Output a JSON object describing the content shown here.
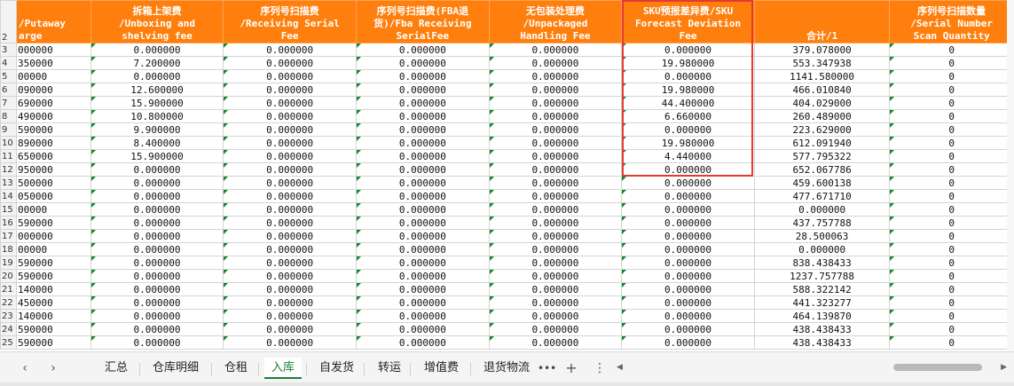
{
  "columns": [
    {
      "lines": [
        "/Putaway",
        "arge"
      ],
      "align": "left"
    },
    {
      "lines": [
        "拆箱上架费",
        "/Unboxing and",
        "shelving fee"
      ]
    },
    {
      "lines": [
        "序列号扫描费",
        "/Receiving Serial",
        "Fee"
      ]
    },
    {
      "lines": [
        "序列号扫描费(FBA退",
        "货)/Fba Receiving",
        "SerialFee"
      ]
    },
    {
      "lines": [
        "无包装处理费",
        "/Unpackaged",
        "Handling Fee"
      ]
    },
    {
      "lines": [
        "SKU预报差异费/SKU",
        "Forecast Deviation",
        "Fee"
      ]
    },
    {
      "lines": [
        "合计/1"
      ]
    },
    {
      "lines": [
        "序列号扫描数量",
        "/Serial Number",
        "Scan Quantity"
      ]
    }
  ],
  "rows": [
    {
      "num": "3",
      "cells": [
        "000000",
        "0.000000",
        "0.000000",
        "0.000000",
        "0.000000",
        "0.000000",
        "379.078000",
        "0"
      ]
    },
    {
      "num": "4",
      "cells": [
        "350000",
        "7.200000",
        "0.000000",
        "0.000000",
        "0.000000",
        "19.980000",
        "553.347938",
        "0"
      ]
    },
    {
      "num": "5",
      "cells": [
        "00000",
        "0.000000",
        "0.000000",
        "0.000000",
        "0.000000",
        "0.000000",
        "1141.580000",
        "0"
      ]
    },
    {
      "num": "6",
      "cells": [
        "090000",
        "12.600000",
        "0.000000",
        "0.000000",
        "0.000000",
        "19.980000",
        "466.010840",
        "0"
      ]
    },
    {
      "num": "7",
      "cells": [
        "690000",
        "15.900000",
        "0.000000",
        "0.000000",
        "0.000000",
        "44.400000",
        "404.029000",
        "0"
      ]
    },
    {
      "num": "8",
      "cells": [
        "490000",
        "10.800000",
        "0.000000",
        "0.000000",
        "0.000000",
        "6.660000",
        "260.489000",
        "0"
      ]
    },
    {
      "num": "9",
      "cells": [
        "590000",
        "9.900000",
        "0.000000",
        "0.000000",
        "0.000000",
        "0.000000",
        "223.629000",
        "0"
      ]
    },
    {
      "num": "10",
      "cells": [
        "890000",
        "8.400000",
        "0.000000",
        "0.000000",
        "0.000000",
        "19.980000",
        "612.091940",
        "0"
      ]
    },
    {
      "num": "11",
      "cells": [
        "650000",
        "15.900000",
        "0.000000",
        "0.000000",
        "0.000000",
        "4.440000",
        "577.795322",
        "0"
      ]
    },
    {
      "num": "12",
      "cells": [
        "950000",
        "0.000000",
        "0.000000",
        "0.000000",
        "0.000000",
        "0.000000",
        "652.067786",
        "0"
      ]
    },
    {
      "num": "13",
      "cells": [
        "500000",
        "0.000000",
        "0.000000",
        "0.000000",
        "0.000000",
        "0.000000",
        "459.600138",
        "0"
      ]
    },
    {
      "num": "14",
      "cells": [
        "050000",
        "0.000000",
        "0.000000",
        "0.000000",
        "0.000000",
        "0.000000",
        "477.671710",
        "0"
      ]
    },
    {
      "num": "15",
      "cells": [
        "00000",
        "0.000000",
        "0.000000",
        "0.000000",
        "0.000000",
        "0.000000",
        "0.000000",
        "0"
      ]
    },
    {
      "num": "16",
      "cells": [
        "590000",
        "0.000000",
        "0.000000",
        "0.000000",
        "0.000000",
        "0.000000",
        "437.757788",
        "0"
      ]
    },
    {
      "num": "17",
      "cells": [
        "000000",
        "0.000000",
        "0.000000",
        "0.000000",
        "0.000000",
        "0.000000",
        "28.500063",
        "0"
      ]
    },
    {
      "num": "18",
      "cells": [
        "00000",
        "0.000000",
        "0.000000",
        "0.000000",
        "0.000000",
        "0.000000",
        "0.000000",
        "0"
      ]
    },
    {
      "num": "19",
      "cells": [
        "590000",
        "0.000000",
        "0.000000",
        "0.000000",
        "0.000000",
        "0.000000",
        "838.438433",
        "0"
      ]
    },
    {
      "num": "20",
      "cells": [
        "590000",
        "0.000000",
        "0.000000",
        "0.000000",
        "0.000000",
        "0.000000",
        "1237.757788",
        "0"
      ]
    },
    {
      "num": "21",
      "cells": [
        "140000",
        "0.000000",
        "0.000000",
        "0.000000",
        "0.000000",
        "0.000000",
        "588.322142",
        "0"
      ]
    },
    {
      "num": "22",
      "cells": [
        "450000",
        "0.000000",
        "0.000000",
        "0.000000",
        "0.000000",
        "0.000000",
        "441.323277",
        "0"
      ]
    },
    {
      "num": "23",
      "cells": [
        "140000",
        "0.000000",
        "0.000000",
        "0.000000",
        "0.000000",
        "0.000000",
        "464.139870",
        "0"
      ]
    },
    {
      "num": "24",
      "cells": [
        "590000",
        "0.000000",
        "0.000000",
        "0.000000",
        "0.000000",
        "0.000000",
        "438.438433",
        "0"
      ]
    },
    {
      "num": "25",
      "cells": [
        "590000",
        "0.000000",
        "0.000000",
        "0.000000",
        "0.000000",
        "0.000000",
        "438.438433",
        "0"
      ]
    }
  ],
  "header_row_num": "2",
  "tabs": {
    "prev_label": "‹",
    "next_label": "›",
    "items": [
      "汇总",
      "仓库明细",
      "仓租",
      "入库",
      "自发货",
      "转运",
      "增值费",
      "退货物流"
    ],
    "active": "入库",
    "more_label": "•••",
    "add_label": "+",
    "menu_label": "⋮"
  },
  "colors": {
    "header_bg": "#ff7f0e",
    "highlight_border": "#e53935",
    "active_tab": "#1a7f37"
  }
}
